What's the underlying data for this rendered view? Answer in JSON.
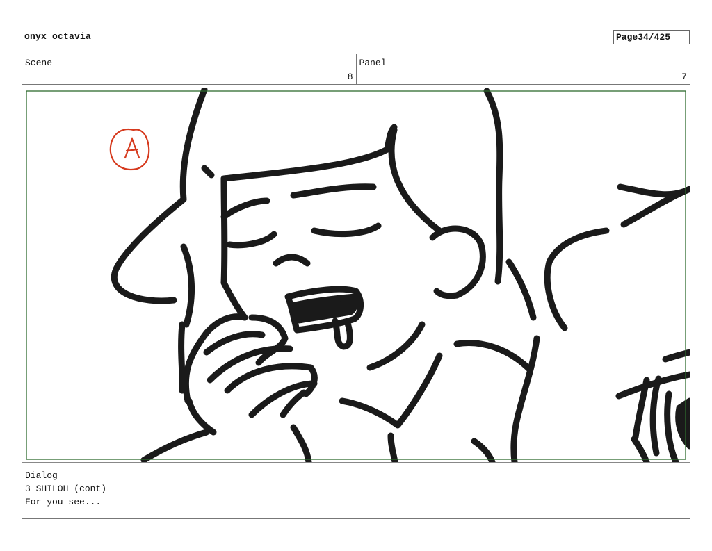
{
  "header": {
    "title": "onyx octavia",
    "page_label": "Page",
    "page_number": "34/425"
  },
  "info": {
    "scene_label": "Scene",
    "scene_value": "8",
    "panel_label": "Panel",
    "panel_value": "7"
  },
  "panel": {
    "frame_color": "#2e6b2e",
    "line_color": "#1a1a1a",
    "annotation_color": "#d63a1e"
  },
  "dialog": {
    "label": "Dialog",
    "character": "3 SHILOH (cont)",
    "line": "For you see..."
  }
}
